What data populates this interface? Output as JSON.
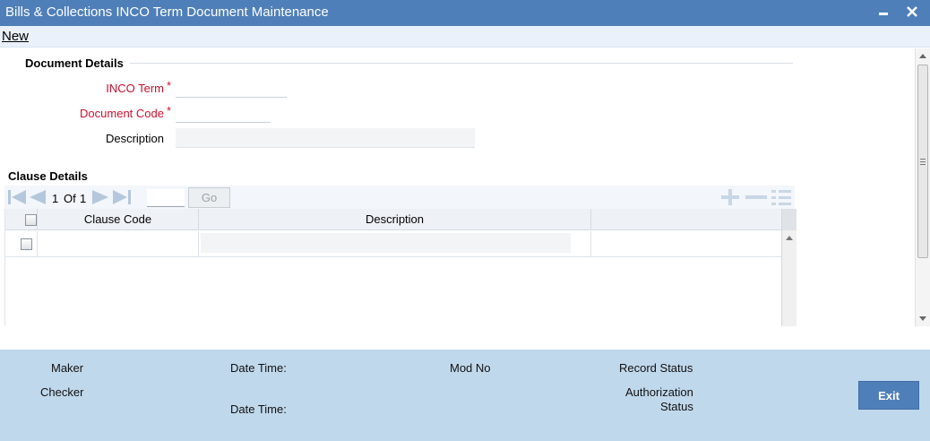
{
  "window": {
    "title": "Bills & Collections INCO Term Document Maintenance",
    "minimize_glyph": "▬",
    "close_glyph": "✕"
  },
  "menu": {
    "new_label": "New"
  },
  "document_details": {
    "section_title": "Document Details",
    "inco_term_label": "INCO Term",
    "inco_term_value": "",
    "document_code_label": "Document Code",
    "document_code_value": "",
    "description_label": "Description",
    "description_value": "",
    "required_mark": "*"
  },
  "clause_details": {
    "section_title": "Clause Details",
    "pager": {
      "current": "1",
      "of_label": "Of",
      "total": "1",
      "go_label": "Go",
      "page_input": ""
    },
    "columns": [
      "Clause Code",
      "Description"
    ],
    "rows": [
      {
        "clause_code": "",
        "description": ""
      }
    ]
  },
  "footer": {
    "maker_label": "Maker",
    "checker_label": "Checker",
    "date_time_label": "Date Time:",
    "date_time_label_2": "Date Time:",
    "mod_no_label": "Mod No",
    "record_status_label": "Record Status",
    "authorization_label": "Authorization",
    "status_label": "Status",
    "exit_label": "Exit"
  },
  "colors": {
    "titlebar": "#4f7fb8",
    "footer": "#c0d8ec",
    "required": "#c8102e",
    "pager_icons": "#b4c7dd"
  },
  "icons": [
    "minimize-icon",
    "close-icon",
    "first-page-icon",
    "previous-page-icon",
    "next-page-icon",
    "last-page-icon",
    "add-row-icon",
    "delete-row-icon",
    "single-view-icon"
  ]
}
